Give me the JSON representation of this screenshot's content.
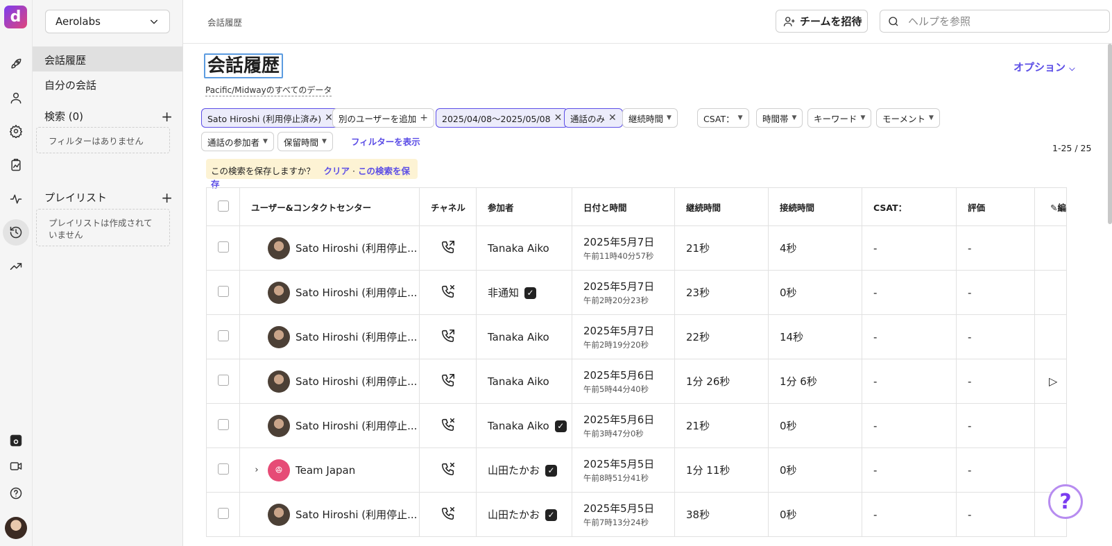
{
  "app": {
    "logo": "d"
  },
  "sidebar": {
    "org": "Aerolabs",
    "items": [
      {
        "label": "会話履歴"
      },
      {
        "label": "自分の会話"
      }
    ],
    "search": {
      "label": "検索 (0)",
      "empty": "フィルターはありません"
    },
    "playlist": {
      "label": "プレイリスト",
      "empty": "プレイリストは作成されていません"
    }
  },
  "header": {
    "breadcrumb": "会話履歴",
    "invite_label": "チームを招待",
    "search_placeholder": "ヘルプを参照"
  },
  "page": {
    "title": "会話履歴",
    "subtitle": "Pacific/Midwayのすべてのデータ",
    "options": "オプション"
  },
  "filters": {
    "user": "Sato Hiroshi (利用停止済み)",
    "add_user": "別のユーザーを追加",
    "date": "2025/04/08〜2025/05/08",
    "type": "通話のみ",
    "duration": "継続時間",
    "csat": "CSAT：",
    "timezone": "時間帯",
    "keyword": "キーワード",
    "moment": "モーメント",
    "participants": "通話の参加者",
    "hold": "保留時間",
    "show": "フィルターを表示"
  },
  "count": "1-25 / 25",
  "savebar": {
    "question": "この検索を保存しますか？",
    "clear": "クリア",
    "sep": "·",
    "save": "この検索を保存"
  },
  "table": {
    "headers": {
      "user": "ユーザー&コンタクトセンター",
      "channel": "チャネル",
      "participant": "参加者",
      "datetime": "日付と時間",
      "duration": "継続時間",
      "connect": "接続時間",
      "csat": "CSAT：",
      "rating": "評価",
      "edit": "編"
    },
    "rows": [
      {
        "user": "Sato Hiroshi (利用停止...",
        "participant": "Tanaka Aiko",
        "date": "2025年5月7日",
        "time": "午前11時40分57秒",
        "duration": "21秒",
        "connect": "4秒",
        "csat": "-",
        "rating": "-",
        "call": "outgoing",
        "check": false,
        "play": false,
        "team": false
      },
      {
        "user": "Sato Hiroshi (利用停止...",
        "participant": "非通知",
        "date": "2025年5月7日",
        "time": "午前2時20分23秒",
        "duration": "23秒",
        "connect": "0秒",
        "csat": "-",
        "rating": "-",
        "call": "missed",
        "check": true,
        "play": false,
        "team": false
      },
      {
        "user": "Sato Hiroshi (利用停止...",
        "participant": "Tanaka Aiko",
        "date": "2025年5月7日",
        "time": "午前2時19分20秒",
        "duration": "22秒",
        "connect": "14秒",
        "csat": "-",
        "rating": "-",
        "call": "outgoing",
        "check": false,
        "play": false,
        "team": false
      },
      {
        "user": "Sato Hiroshi (利用停止...",
        "participant": "Tanaka Aiko",
        "date": "2025年5月6日",
        "time": "午前5時44分40秒",
        "duration": "1分 26秒",
        "connect": "1分 6秒",
        "csat": "-",
        "rating": "-",
        "call": "outgoing",
        "check": false,
        "play": true,
        "team": false
      },
      {
        "user": "Sato Hiroshi (利用停止...",
        "participant": "Tanaka Aiko",
        "date": "2025年5月6日",
        "time": "午前3時47分0秒",
        "duration": "21秒",
        "connect": "0秒",
        "csat": "-",
        "rating": "-",
        "call": "missed",
        "check": true,
        "play": false,
        "team": false
      },
      {
        "user": "Team Japan",
        "participant": "山田たかお",
        "date": "2025年5月5日",
        "time": "午前8時51分41秒",
        "duration": "1分 11秒",
        "connect": "0秒",
        "csat": "-",
        "rating": "-",
        "call": "missed",
        "check": true,
        "play": false,
        "team": true
      },
      {
        "user": "Sato Hiroshi (利用停止...",
        "participant": "山田たかお",
        "date": "2025年5月5日",
        "time": "午前7時13分24秒",
        "duration": "38秒",
        "connect": "0秒",
        "csat": "-",
        "rating": "-",
        "call": "missed",
        "check": true,
        "play": false,
        "team": false
      }
    ]
  },
  "help": "?"
}
